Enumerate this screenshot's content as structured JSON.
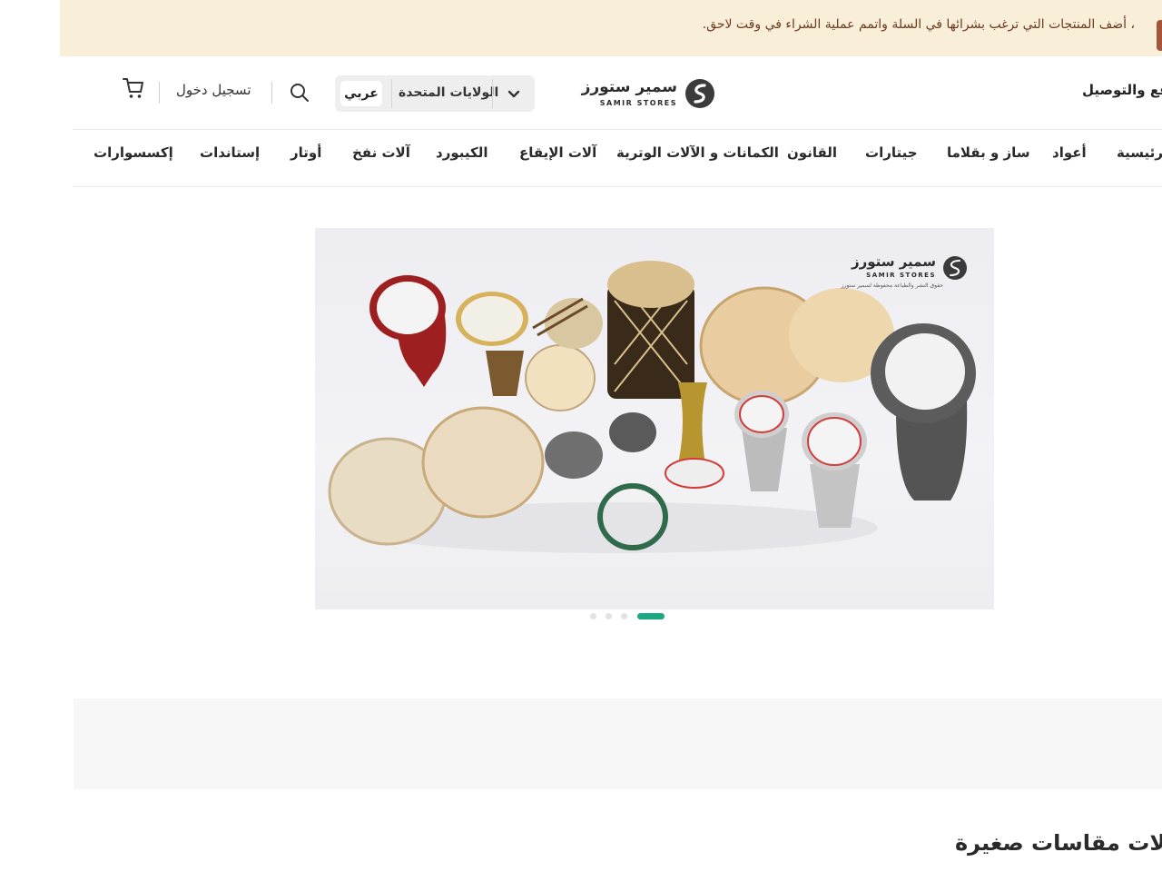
{
  "banner": {
    "message": "أضف المنتجات التي ترغب بشرائها في السلة واتمم عملية الشراء في وقت لاحق.",
    "bullet": "،"
  },
  "header": {
    "payment_link": "دفع والتوصيل",
    "logo": {
      "name_ar": "سمير ستورز",
      "name_en": "SAMIR STORES"
    },
    "region": {
      "country": "الولايات المتحدة",
      "language": "عربي"
    },
    "login": "تسجيل دخول",
    "icons": {
      "search": "search-icon",
      "cart": "cart-icon",
      "dropdown": "chevron-down-icon"
    }
  },
  "nav": {
    "items": [
      "الرئيسية",
      "أعواد",
      "ساز و بقلاما",
      "جيتارات",
      "القانون",
      "الكمانات و الآلات الوترية",
      "آلات الإيقاع",
      "الكيبورد",
      "آلات نفخ",
      "أوتار",
      "إستاندات",
      "إكسسوارات"
    ]
  },
  "hero": {
    "watermark_ar": "سمير ستورز",
    "watermark_en": "SAMIR STORES",
    "watermark_note": "حقوق النشر والطباعة محفوظة لسمير ستورز",
    "slides": 4,
    "active_slide": 4
  },
  "section": {
    "title": "و آلات مقاسات صغيرة"
  },
  "colors": {
    "banner_bg": "#f9efd9",
    "banner_text": "#6b3a1f",
    "accent": "#1aa781",
    "region_bg": "#eeeeee"
  }
}
